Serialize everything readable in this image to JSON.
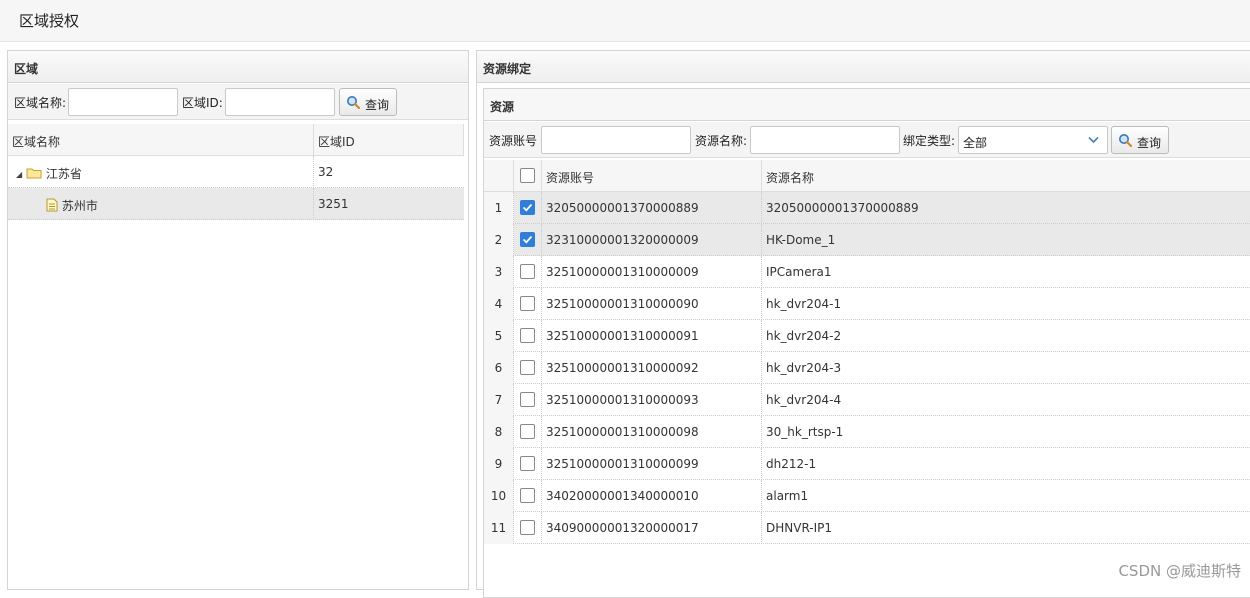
{
  "page": {
    "title": "区域授权"
  },
  "left": {
    "panel_title": "区域",
    "name_label": "区域名称:",
    "name_value": "",
    "id_label": "区域ID:",
    "id_value": "",
    "search_label": "查询",
    "columns": [
      "区域名称",
      "区域ID"
    ],
    "rows": [
      {
        "name": "江苏省",
        "id": "32"
      },
      {
        "name": "苏州市",
        "id": "3251"
      }
    ]
  },
  "right": {
    "panel_title": "资源绑定",
    "sub_title": "资源",
    "account_label": "资源账号",
    "account_value": "",
    "name_label": "资源名称:",
    "name_value": "",
    "type_label": "绑定类型:",
    "type_value": "全部",
    "search_label": "查询",
    "columns": [
      "资源账号",
      "资源名称"
    ],
    "rows": [
      {
        "num": "1",
        "checked": true,
        "account": "32050000001370000889",
        "name": "32050000001370000889"
      },
      {
        "num": "2",
        "checked": true,
        "account": "32310000001320000009",
        "name": "HK-Dome_1"
      },
      {
        "num": "3",
        "checked": false,
        "account": "32510000001310000009",
        "name": "IPCamera1"
      },
      {
        "num": "4",
        "checked": false,
        "account": "32510000001310000090",
        "name": "hk_dvr204-1"
      },
      {
        "num": "5",
        "checked": false,
        "account": "32510000001310000091",
        "name": "hk_dvr204-2"
      },
      {
        "num": "6",
        "checked": false,
        "account": "32510000001310000092",
        "name": "hk_dvr204-3"
      },
      {
        "num": "7",
        "checked": false,
        "account": "32510000001310000093",
        "name": "hk_dvr204-4"
      },
      {
        "num": "8",
        "checked": false,
        "account": "32510000001310000098",
        "name": "30_hk_rtsp-1"
      },
      {
        "num": "9",
        "checked": false,
        "account": "32510000001310000099",
        "name": "dh212-1"
      },
      {
        "num": "10",
        "checked": false,
        "account": "34020000001340000010",
        "name": "alarm1"
      },
      {
        "num": "11",
        "checked": false,
        "account": "34090000001320000017",
        "name": "DHNVR-IP1"
      }
    ]
  },
  "watermark": "CSDN @威迪斯特",
  "colors": {
    "accent": "#2f7fd8",
    "selected_row": "#e9e9e9"
  }
}
